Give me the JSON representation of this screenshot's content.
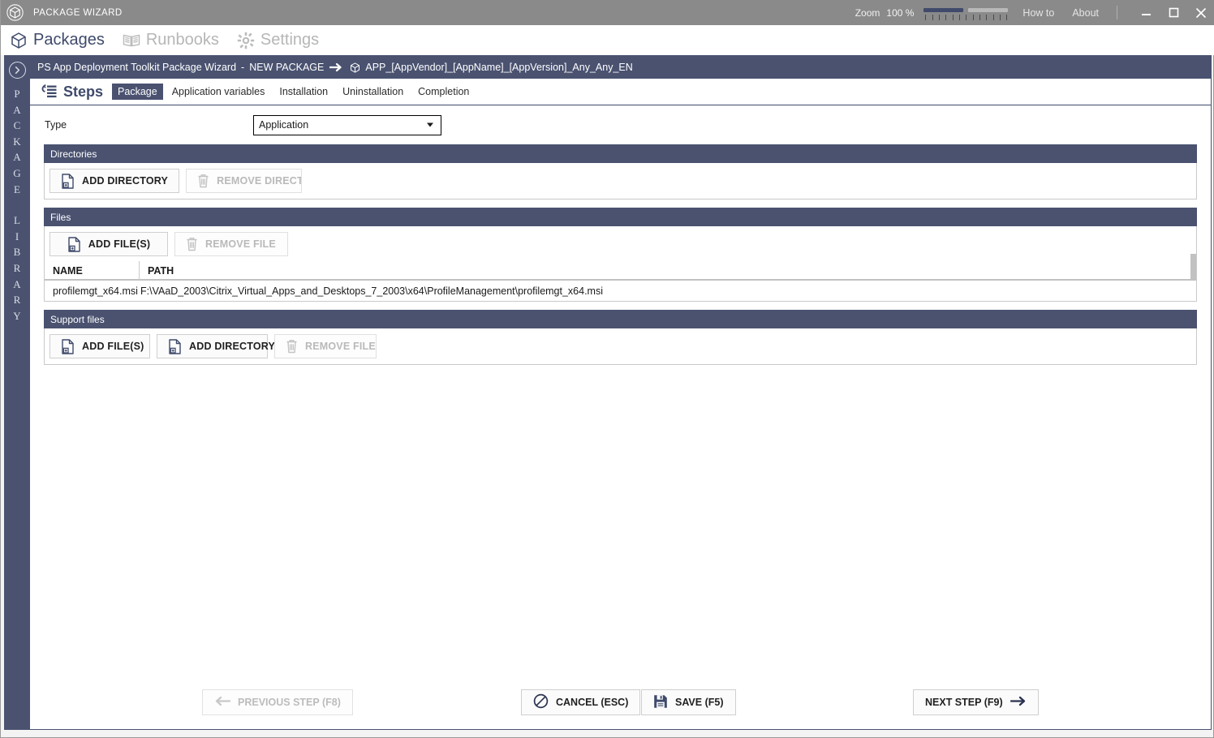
{
  "titlebar": {
    "app_icon": "cube-icon",
    "title": "PACKAGE WIZARD",
    "zoom_label": "Zoom",
    "zoom_value": "100 %",
    "zoom_percent": 50,
    "how_to": "How to",
    "about": "About",
    "minimize": "minimize-icon",
    "maximize": "maximize-icon",
    "close": "close-icon"
  },
  "nav": {
    "items": [
      {
        "label": "Packages",
        "icon": "cube-icon",
        "active": true
      },
      {
        "label": "Runbooks",
        "icon": "book-icon",
        "active": false
      },
      {
        "label": "Settings",
        "icon": "gear-icon",
        "active": false
      }
    ]
  },
  "sidebar": {
    "toggle_icon": "chevron-right-circle-icon",
    "letters_top": [
      "P",
      "A",
      "C",
      "K",
      "A",
      "G",
      "E"
    ],
    "letters_bottom": [
      "L",
      "I",
      "B",
      "R",
      "A",
      "R",
      "Y"
    ],
    "full_label": "PACKAGE LIBRARY"
  },
  "breadcrumb": {
    "app": "PS App Deployment Toolkit Package Wizard",
    "dash": "-",
    "mode": "NEW PACKAGE",
    "arrow_icon": "arrow-right-icon",
    "package_icon": "cube-icon",
    "package_name": "APP_[AppVendor]_[AppName]_[AppVersion]_Any_Any_EN"
  },
  "steps": {
    "icon": "steps-list-icon",
    "label": "Steps",
    "tabs": [
      {
        "label": "Package",
        "selected": true
      },
      {
        "label": "Application variables",
        "selected": false
      },
      {
        "label": "Installation",
        "selected": false
      },
      {
        "label": "Uninstallation",
        "selected": false
      },
      {
        "label": "Completion",
        "selected": false
      }
    ]
  },
  "form": {
    "type_label": "Type",
    "type_value": "Application",
    "type_options": [
      "Application"
    ]
  },
  "directories": {
    "header": "Directories",
    "add_button": "ADD DIRECTORY",
    "add_icon": "add-file-icon",
    "remove_button": "REMOVE DIRECTO",
    "remove_icon": "trash-icon",
    "remove_disabled": true
  },
  "files": {
    "header": "Files",
    "add_button": "ADD FILE(S)",
    "add_icon": "add-file-icon",
    "remove_button": "REMOVE FILE",
    "remove_icon": "trash-icon",
    "remove_disabled": true,
    "columns": [
      "NAME",
      "PATH"
    ],
    "rows": [
      {
        "name": "profilemgt_x64.msi",
        "path": "F:\\VAaD_2003\\Citrix_Virtual_Apps_and_Desktops_7_2003\\x64\\ProfileManagement\\profilemgt_x64.msi"
      }
    ]
  },
  "support_files": {
    "header": "Support files",
    "add_files_button": "ADD FILE(S)",
    "add_files_icon": "add-file-icon",
    "add_dir_button": "ADD DIRECTORY",
    "add_dir_icon": "add-file-icon",
    "remove_button": "REMOVE FILE",
    "remove_icon": "trash-icon",
    "remove_disabled": true
  },
  "footer": {
    "previous": "PREVIOUS STEP (F8)",
    "previous_icon": "arrow-left-icon",
    "previous_disabled": true,
    "cancel": "CANCEL (ESC)",
    "cancel_icon": "no-entry-icon",
    "save": "SAVE (F5)",
    "save_icon": "floppy-icon",
    "next": "NEXT STEP (F9)",
    "next_icon": "arrow-right-icon"
  },
  "colors": {
    "accent": "#4a5270",
    "titlebar": "#8a8a8a",
    "panel_header": "#4a5270",
    "text": "#1f1f1f"
  }
}
